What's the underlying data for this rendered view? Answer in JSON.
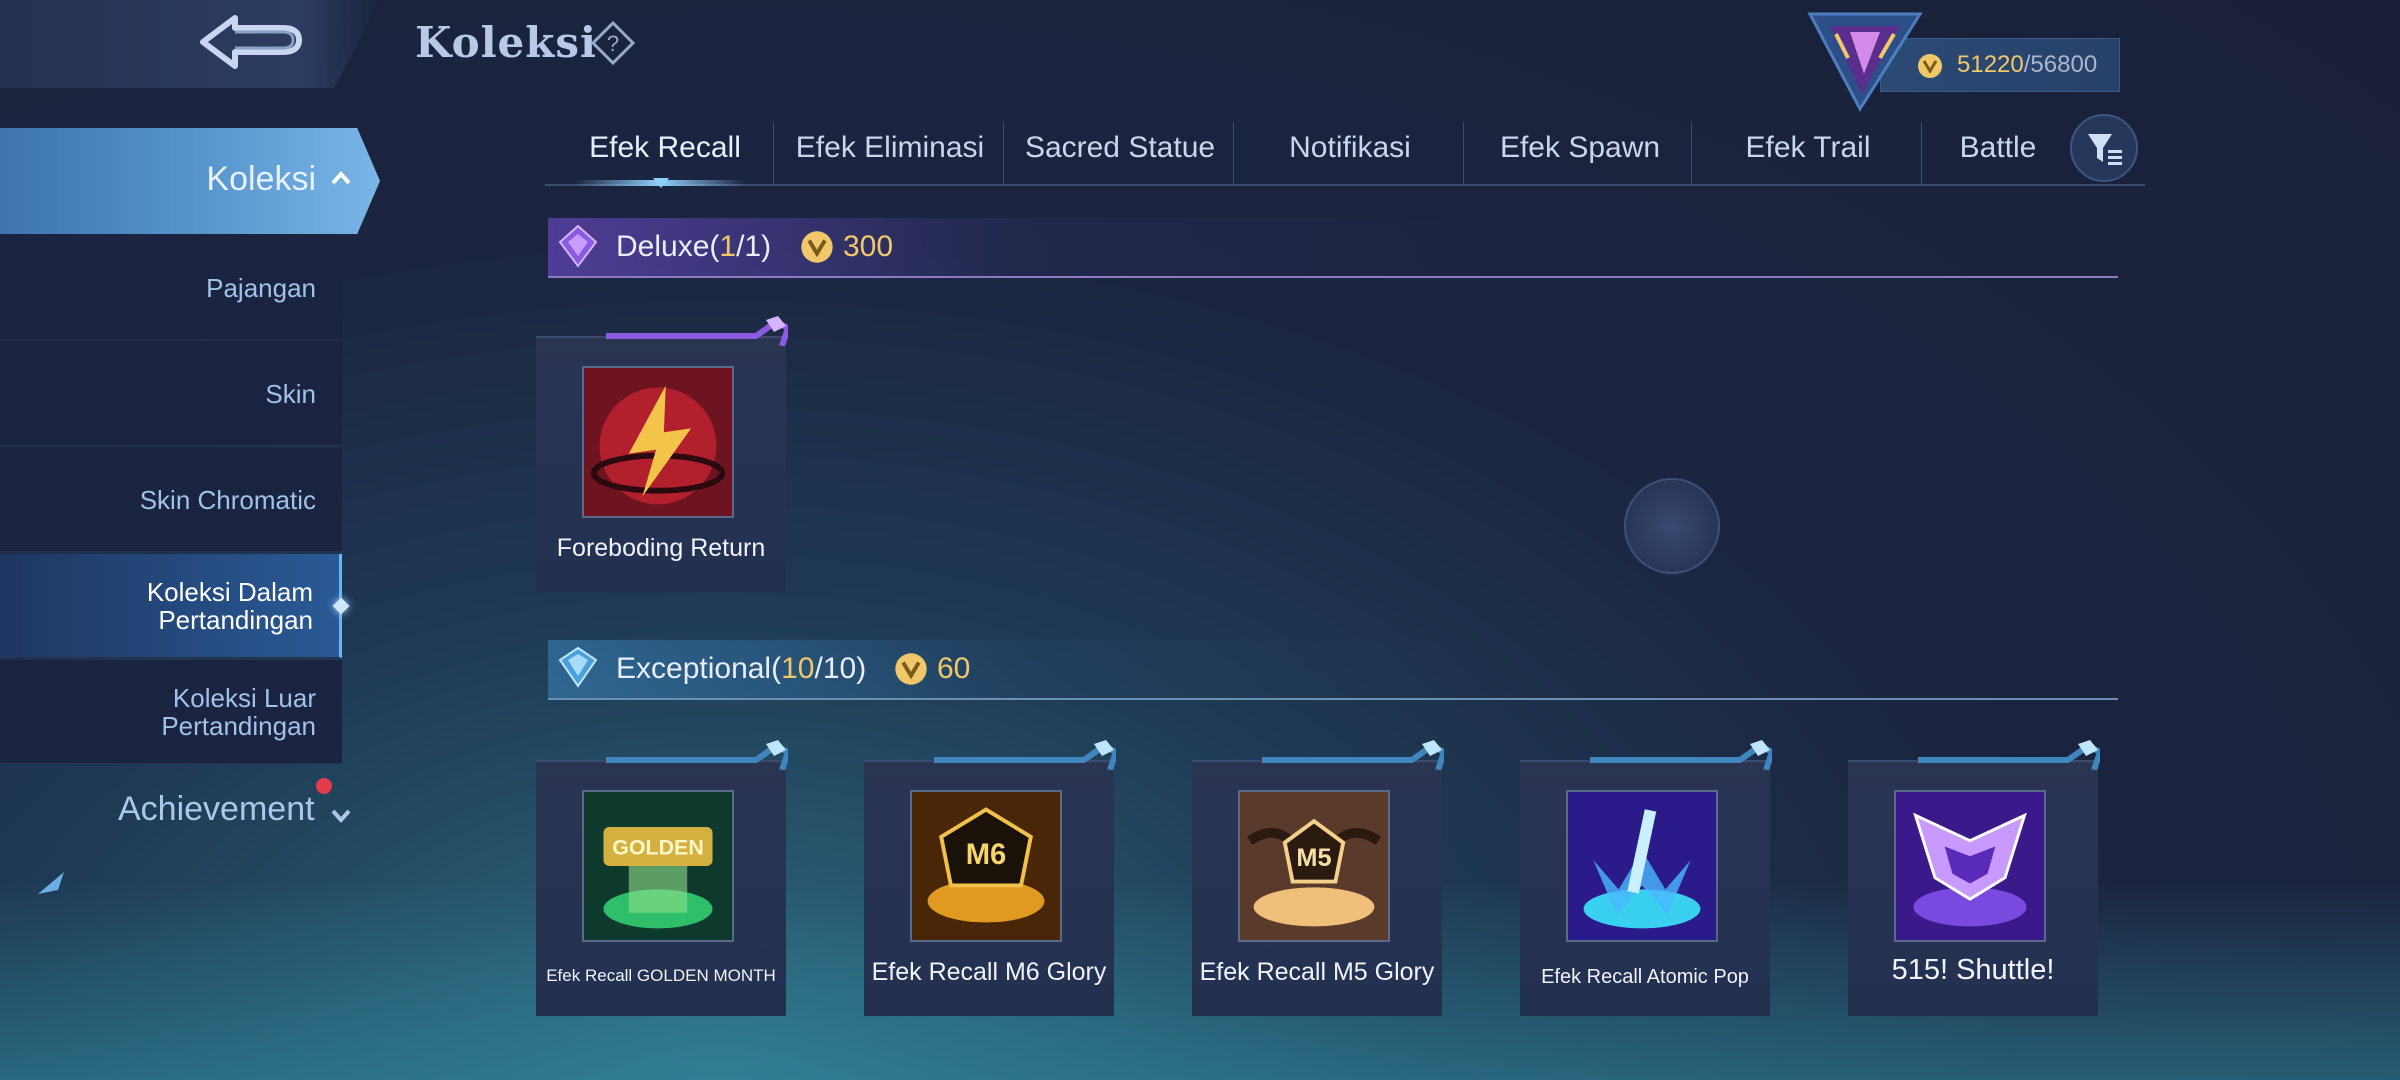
{
  "header": {
    "title": "Koleksi",
    "points_current": "51220",
    "points_separator": "/",
    "points_max": "56800"
  },
  "sidebar": {
    "main_label": "Koleksi",
    "items": [
      {
        "label": "Pajangan"
      },
      {
        "label": "Skin"
      },
      {
        "label": "Skin Chromatic"
      },
      {
        "label": "Koleksi Dalam Pertandingan",
        "line1": "Koleksi Dalam",
        "line2": "Pertandingan"
      },
      {
        "label": "Koleksi Luar Pertandingan",
        "line1": "Koleksi Luar",
        "line2": "Pertandingan"
      }
    ],
    "achievement_label": "Achievement"
  },
  "tabs": [
    {
      "label": "Efek Recall"
    },
    {
      "label": "Efek Eliminasi"
    },
    {
      "label": "Sacred Statue"
    },
    {
      "label": "Notifikasi"
    },
    {
      "label": "Efek Spawn"
    },
    {
      "label": "Efek Trail"
    },
    {
      "label": "Battle"
    }
  ],
  "sections": {
    "deluxe": {
      "name": "Deluxe",
      "count_open": "(",
      "count": "1",
      "count_rest": "/1)",
      "price": "300",
      "items": [
        {
          "name": "Foreboding Return"
        }
      ]
    },
    "exceptional": {
      "name": "Exceptional",
      "count_open": "(",
      "count": "10",
      "count_rest": "/10)",
      "price": "60",
      "items": [
        {
          "name": "Efek Recall GOLDEN MONTH",
          "art_text": "GOLDEN"
        },
        {
          "name": "Efek Recall M6 Glory",
          "art_text": "M6"
        },
        {
          "name": "Efek Recall M5 Glory",
          "art_text": "M5"
        },
        {
          "name": "Efek Recall Atomic Pop"
        },
        {
          "name": "515! Shuttle!"
        }
      ]
    }
  },
  "colors": {
    "accent_gold": "#f0c86a",
    "tab_active_glow": "#8fd0ff",
    "deluxe_purple": "#8a5ae0",
    "exceptional_blue": "#4aa0d8",
    "notification_red": "#e53c4c"
  },
  "icons": [
    "back-arrow-icon",
    "help-icon",
    "rank-emblem-icon",
    "battle-point-coin-icon",
    "filter-icon",
    "deluxe-gem-icon",
    "exceptional-gem-icon",
    "chevron-up-icon",
    "chevron-down-icon"
  ]
}
